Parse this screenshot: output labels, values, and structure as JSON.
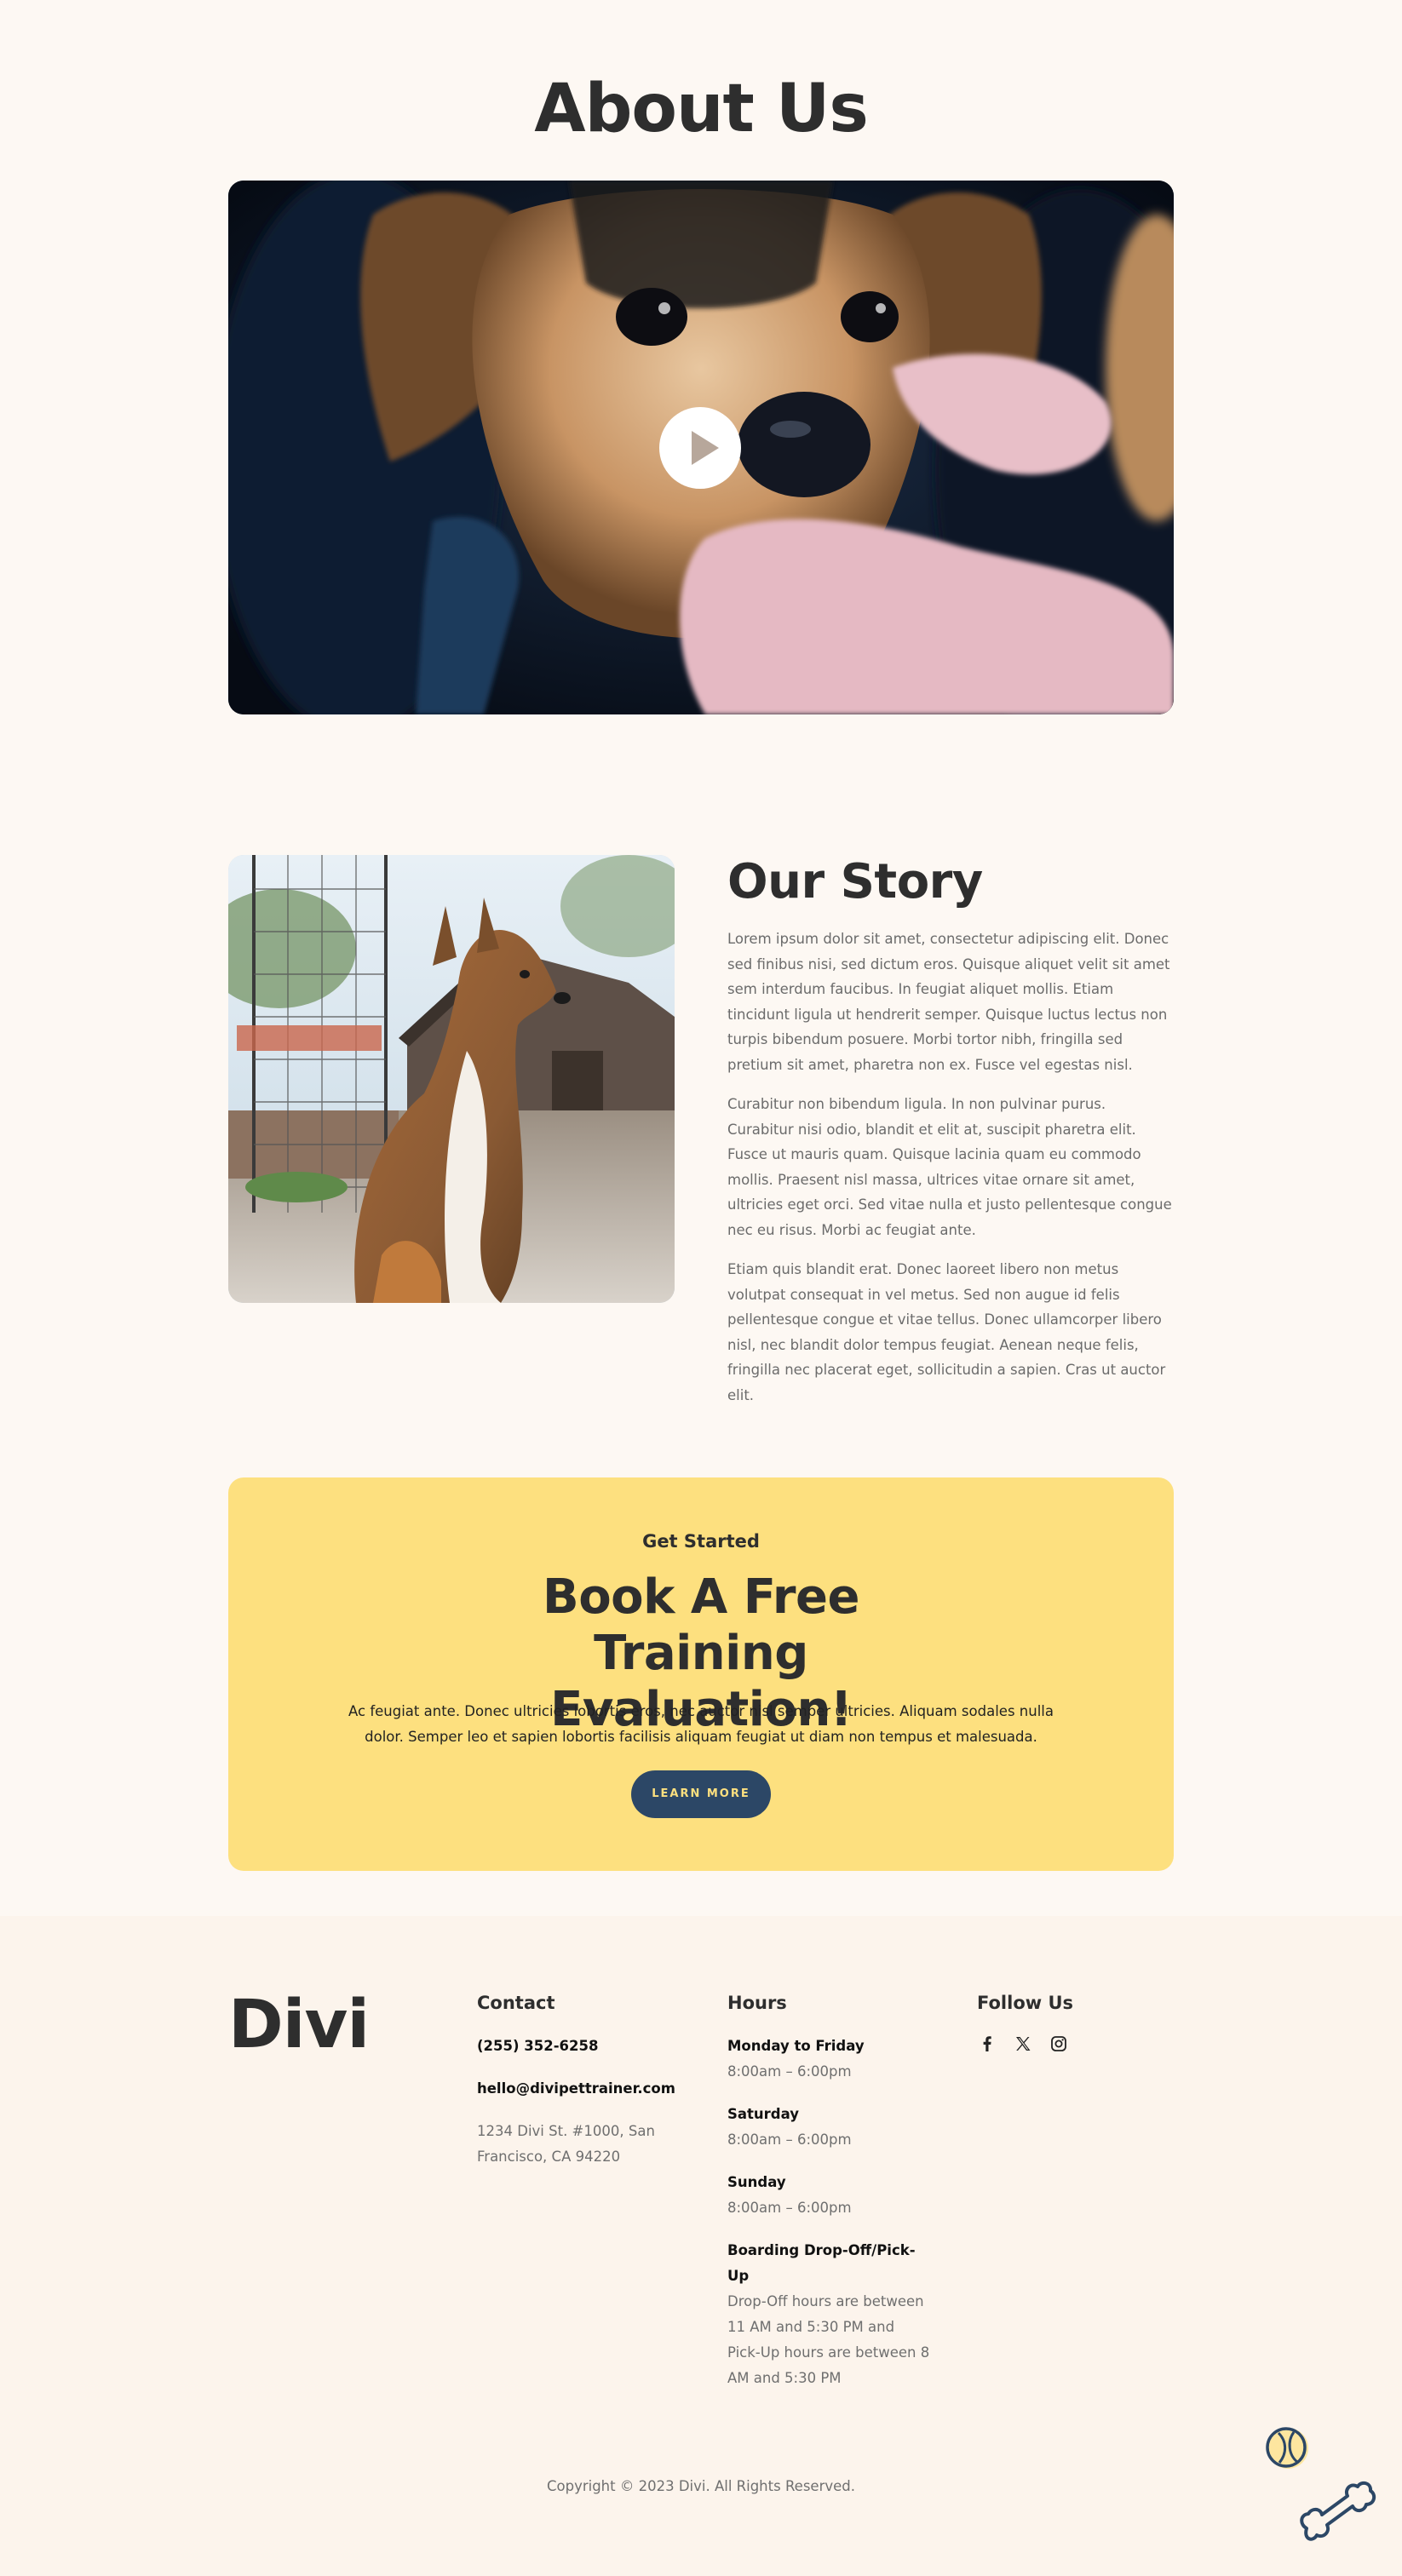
{
  "about": {
    "title": "About Us"
  },
  "story": {
    "title": "Our Story",
    "paragraphs": [
      "Lorem ipsum dolor sit amet, consectetur adipiscing elit. Donec sed finibus nisi, sed dictum eros. Quisque aliquet velit sit amet sem interdum faucibus. In feugiat aliquet mollis. Etiam tincidunt ligula ut hendrerit semper. Quisque luctus lectus non turpis bibendum posuere. Morbi tortor nibh, fringilla sed pretium sit amet, pharetra non ex. Fusce vel egestas nisl.",
      "Curabitur non bibendum ligula. In non pulvinar purus. Curabitur nisi odio, blandit et elit at, suscipit pharetra elit. Fusce ut mauris quam. Quisque lacinia quam eu commodo mollis. Praesent nisl massa, ultrices vitae ornare sit amet, ultricies eget orci. Sed vitae nulla et justo pellentesque congue nec eu risus. Morbi ac feugiat ante.",
      "Etiam quis blandit erat. Donec laoreet libero non metus volutpat consequat in vel metus. Sed non augue id felis pellentesque congue et vitae tellus. Donec ullamcorper libero nisl, nec blandit dolor tempus feugiat. Aenean neque felis, fringilla nec placerat eget, sollicitudin a sapien. Cras ut auctor elit."
    ]
  },
  "cta": {
    "eyebrow": "Get Started",
    "title": "Book A Free Training Evaluation!",
    "text": "Ac feugiat ante. Donec ultricies lobortis eros, nec auctor nisl semper ultricies. Aliquam sodales nulla dolor. Semper leo et sapien lobortis facilisis aliquam feugiat ut diam non tempus et malesuada.",
    "button_label": "LEARN MORE",
    "background": "#fde07f",
    "button_color": "#2c4766"
  },
  "footer": {
    "logo": "Divi",
    "contact": {
      "heading": "Contact",
      "phone": "(255) 352-6258",
      "email": "hello@divipettrainer.com",
      "address": "1234 Divi St. #1000, San Francisco, CA 94220"
    },
    "hours": {
      "heading": "Hours",
      "items": [
        {
          "label": "Monday to Friday",
          "value": "8:00am – 6:00pm"
        },
        {
          "label": "Saturday",
          "value": "8:00am – 6:00pm"
        },
        {
          "label": "Sunday",
          "value": "8:00am – 6:00pm"
        },
        {
          "label": "Boarding Drop-Off/Pick-Up",
          "value": "Drop-Off hours are between 11 AM and 5:30 PM and Pick-Up hours are between 8 AM and 5:30 PM"
        }
      ]
    },
    "follow": {
      "heading": "Follow Us",
      "icons": [
        "facebook-icon",
        "x-twitter-icon",
        "instagram-icon"
      ]
    },
    "copyright": "Copyright © 2023 Divi. All Rights Reserved."
  },
  "colors": {
    "page_bg": "#fdf8f3",
    "footer_bg": "#fcf4ec",
    "heading": "#2e2e2e",
    "accent_yellow": "#fde07f",
    "accent_navy": "#2c4766"
  }
}
